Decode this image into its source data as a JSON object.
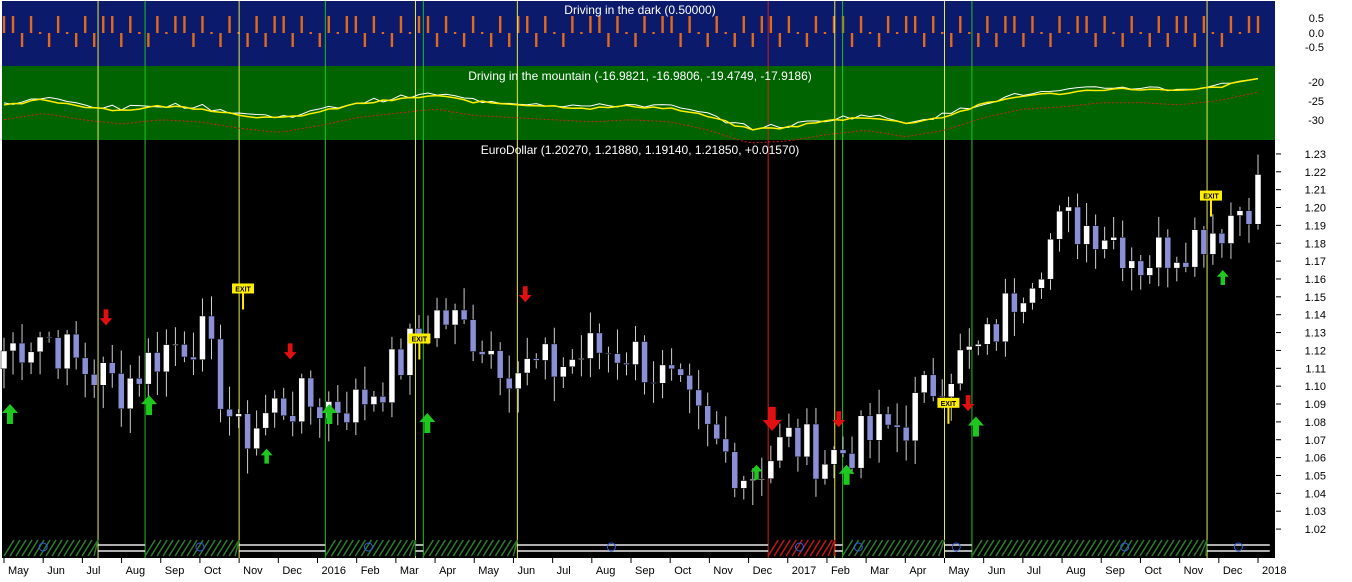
{
  "panels": {
    "top": {
      "title": "Driving in the dark (0.50000)",
      "ticks": [
        "0.5",
        "0.0",
        "-0.5"
      ]
    },
    "mid": {
      "title": "Driving in the mountain (-16.9821, -16.9806, -19.4749, -17.9186)",
      "ticks": [
        "-20",
        "-25",
        "-30"
      ]
    },
    "main": {
      "title": "EuroDollar (1.20270, 1.21880, 1.19140, 1.21850, +0.01570)"
    }
  },
  "x_labels": [
    "May",
    "Jun",
    "Jul",
    "Aug",
    "Sep",
    "Oct",
    "Nov",
    "Dec",
    "2016",
    "Feb",
    "Mar",
    "Apr",
    "May",
    "Jun",
    "Jul",
    "Aug",
    "Sep",
    "Oct",
    "Nov",
    "Dec",
    "2017",
    "Feb",
    "Mar",
    "Apr",
    "May",
    "Jun",
    "Jul",
    "Aug",
    "Sep",
    "Oct",
    "Nov",
    "Dec",
    "2018"
  ],
  "exit_label": "EXIT",
  "colors": {
    "top_bg": "#0c1a6b",
    "mid_bg": "#006400",
    "main_bg": "#000000",
    "signal_bar": "#e06a1e",
    "bull_candle": "#ffffff",
    "bear_candle": "#8a8fd6",
    "up_arrow": "#1ec81e",
    "down_arrow": "#e01010",
    "exit_flag": "#ffee00",
    "line_yellow": "#ffee00",
    "line_white": "#ffffff",
    "line_red_dotted": "#d02020",
    "vline_yellow": "#e8e84a",
    "vline_green": "#22c022",
    "vline_red": "#d02020"
  },
  "chart_data": [
    {
      "type": "bar",
      "title": "Driving in the dark (0.50000)",
      "ylim": [
        -0.75,
        0.75
      ],
      "yticks": [
        0.5,
        0.0,
        -0.5
      ]
    },
    {
      "type": "line",
      "title": "Driving in the mountain (-16.9821, -16.9806, -19.4749, -17.9186)",
      "ylim": [
        -33,
        -17
      ],
      "yticks": [
        -20,
        -25,
        -30
      ],
      "series": [],
      "x": [
        "May",
        "Jun",
        "Jul",
        "Aug",
        "Sep",
        "Oct",
        "Nov",
        "Dec",
        "2016",
        "Feb",
        "Mar",
        "Apr",
        "May",
        "Jun",
        "Jul",
        "Aug",
        "Sep",
        "Oct",
        "Nov",
        "Dec",
        "2017",
        "Feb",
        "Mar",
        "Apr",
        "May",
        "Jun",
        "Jul",
        "Aug",
        "Sep",
        "Oct",
        "Nov",
        "Dec",
        "2018"
      ],
      "values_yellow": [
        -25.5,
        -24,
        -25.5,
        -26.5,
        -25.5,
        -26,
        -27.5,
        -28.5,
        -27,
        -25,
        -24,
        -23,
        -24.5,
        -25,
        -25.5,
        -26,
        -25.5,
        -26,
        -28,
        -31,
        -30.5,
        -29,
        -28,
        -29.5,
        -28,
        -25,
        -23,
        -22.5,
        -21.5,
        -21.5,
        -22,
        -21,
        -19
      ]
    },
    {
      "type": "candlestick",
      "title": "EuroDollar (1.20270, 1.21880, 1.19140, 1.21850, +0.01570)",
      "ylim": [
        1.015,
        1.235
      ],
      "yticks": [
        1.23,
        1.22,
        1.21,
        1.2,
        1.19,
        1.18,
        1.17,
        1.16,
        1.15,
        1.14,
        1.13,
        1.12,
        1.11,
        1.1,
        1.09,
        1.08,
        1.07,
        1.06,
        1.05,
        1.04,
        1.03,
        1.02
      ],
      "x": [
        "May",
        "Jun",
        "Jul",
        "Aug",
        "Sep",
        "Oct",
        "Nov",
        "Dec",
        "2016",
        "Feb",
        "Mar",
        "Apr",
        "May",
        "Jun",
        "Jul",
        "Aug",
        "Sep",
        "Oct",
        "Nov",
        "Dec",
        "2017",
        "Feb",
        "Mar",
        "Apr",
        "May",
        "Jun",
        "Jul",
        "Aug",
        "Sep",
        "Oct",
        "Nov",
        "Dec",
        "2018"
      ],
      "close_approx": [
        1.12,
        1.13,
        1.11,
        1.1,
        1.12,
        1.13,
        1.07,
        1.09,
        1.09,
        1.09,
        1.11,
        1.14,
        1.13,
        1.11,
        1.11,
        1.12,
        1.12,
        1.1,
        1.07,
        1.05,
        1.07,
        1.06,
        1.07,
        1.08,
        1.11,
        1.12,
        1.16,
        1.19,
        1.19,
        1.17,
        1.18,
        1.19,
        1.21
      ]
    }
  ]
}
